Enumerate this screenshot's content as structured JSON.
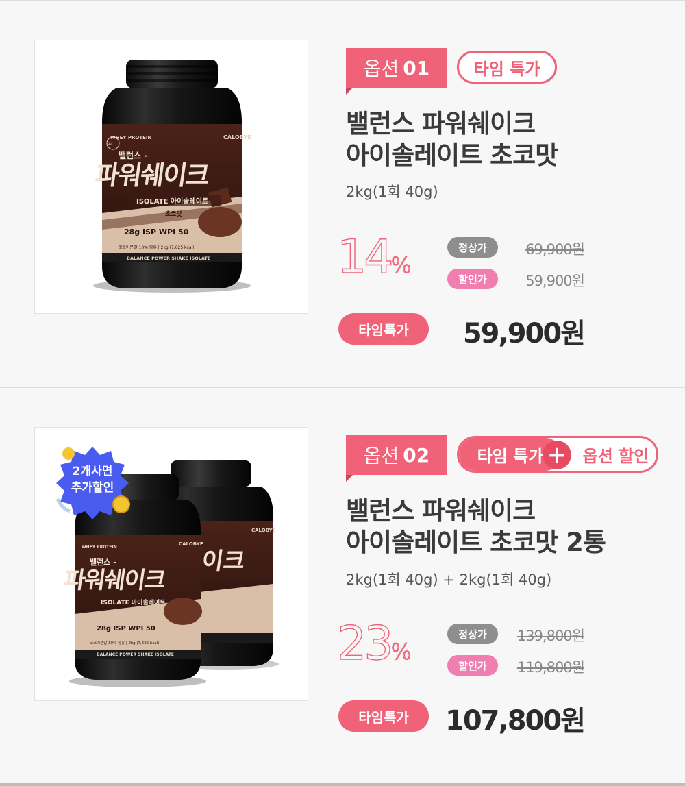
{
  "options": [
    {
      "tag_label": "옵션",
      "tag_num": "01",
      "badge": "타임 특가",
      "title_line1": "밸런스 파워쉐이크",
      "title_line2": "아이솔레이트 초코맛",
      "subtitle": "2kg(1회 40g)",
      "discount_num": "14",
      "discount_unit": "%",
      "regular_label": "정상가",
      "regular_price": "69,900원",
      "sale_label": "할인가",
      "sale_price": "59,900원",
      "time_label": "타임특가",
      "final_price": "59,900원"
    },
    {
      "tag_label": "옵션",
      "tag_num": "02",
      "badge_left": "타임 특가",
      "badge_plus": "+",
      "badge_right": "옵션 할인",
      "title_line1": "밸런스 파워쉐이크",
      "title_line2": "아이솔레이트 초코맛 2통",
      "subtitle": "2kg(1회 40g) + 2kg(1회 40g)",
      "discount_num": "23",
      "discount_unit": "%",
      "regular_label": "정상가",
      "regular_price": "139,800원",
      "sale_label": "할인가",
      "sale_price": "119,800원",
      "time_label": "타임특가",
      "final_price": "107,800원",
      "promo_line1": "2개사면",
      "promo_line2": "추가할인"
    }
  ],
  "product_label": {
    "brand": "CALOBYE",
    "whey": "WHEY PROTEIN",
    "name_small": "밸런스 -",
    "name_big": "파워쉐이크",
    "isolate": "ISOLATE 아이솔레이트",
    "flavor": "초코맛",
    "stats": [
      "28g",
      "ISP",
      "WPI",
      "50"
    ],
    "bottom": "BALANCE POWER SHAKE ISOLATE"
  }
}
